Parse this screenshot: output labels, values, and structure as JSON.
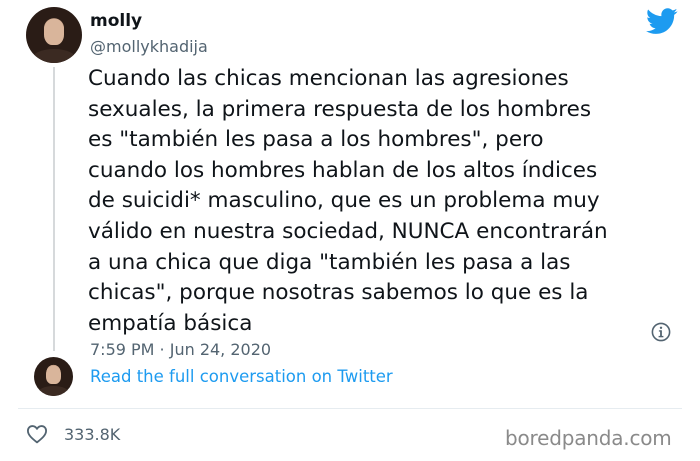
{
  "tweet": {
    "display_name": "molly",
    "handle": "@mollykhadija",
    "text": "Cuando las chicas mencionan las agresiones\nsexuales, la primera respuesta de los hombres\nes \"también les pasa a los hombres\", pero\ncuando los hombres hablan de los altos índices\nde suicidi* masculino, que es un problema muy\nválido en nuestra sociedad, NUNCA encontrarán\na una chica que diga \"también les pasa a las\nchicas\", porque nosotras sabemos lo que es la\nempatía básica",
    "timestamp": "7:59 PM · Jun 24, 2020",
    "read_more": "Read the full conversation on Twitter",
    "likes": "333.8K"
  },
  "watermark": "boredpanda.com",
  "colors": {
    "twitter_blue": "#1d9bf0",
    "text_primary": "#0f1419",
    "text_secondary": "#536471"
  },
  "icons": {
    "brand": "twitter-bird-icon",
    "info": "info-icon",
    "like": "heart-icon"
  }
}
